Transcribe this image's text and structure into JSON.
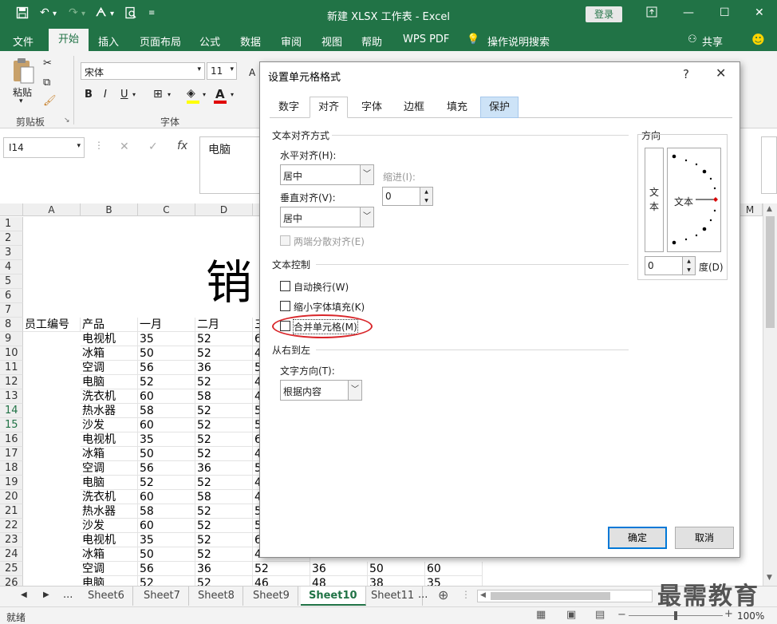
{
  "window": {
    "title": "新建 XLSX 工作表 - Excel",
    "login_label": "登录"
  },
  "menu": {
    "file": "文件",
    "home": "开始",
    "insert": "插入",
    "page_layout": "页面布局",
    "formulas": "公式",
    "data": "数据",
    "review": "审阅",
    "view": "视图",
    "help": "帮助",
    "wps_pdf": "WPS PDF",
    "tell_me": "操作说明搜索",
    "share": "共享"
  },
  "ribbon": {
    "paste": "粘贴",
    "clipboard_group": "剪贴板",
    "font_name": "宋体",
    "font_size": "11",
    "bold": "B",
    "italic": "I",
    "underline": "U",
    "font_group": "字体",
    "font_color_letter": "A",
    "font_color": "#e00000",
    "fill_color": "#ffff00"
  },
  "formula_bar": {
    "name_box": "I14",
    "cancel": "✕",
    "enter": "✓",
    "fx": "fx",
    "content": "电脑"
  },
  "grid": {
    "columns": [
      "A",
      "B",
      "C",
      "D",
      "M"
    ],
    "rows": [
      "1",
      "2",
      "3",
      "4",
      "5",
      "6",
      "7",
      "8",
      "9",
      "10",
      "11",
      "12",
      "13",
      "14",
      "15",
      "16",
      "17",
      "18",
      "19",
      "20",
      "21",
      "22",
      "23",
      "24",
      "25",
      "26"
    ],
    "big_title": "销",
    "header": [
      "员工编号",
      "产品",
      "一月",
      "二月",
      "三"
    ],
    "data": [
      [
        "电视机",
        "35",
        "52",
        "6"
      ],
      [
        "冰箱",
        "50",
        "52",
        "4"
      ],
      [
        "空调",
        "56",
        "36",
        "5"
      ],
      [
        "电脑",
        "52",
        "52",
        "4"
      ],
      [
        "洗衣机",
        "60",
        "58",
        "4"
      ],
      [
        "热水器",
        "58",
        "52",
        "5"
      ],
      [
        "沙发",
        "60",
        "52",
        "5"
      ],
      [
        "电视机",
        "35",
        "52",
        "6"
      ],
      [
        "冰箱",
        "50",
        "52",
        "4"
      ],
      [
        "空调",
        "56",
        "36",
        "5"
      ],
      [
        "电脑",
        "52",
        "52",
        "4"
      ],
      [
        "洗衣机",
        "60",
        "58",
        "4"
      ],
      [
        "热水器",
        "58",
        "52",
        "5"
      ],
      [
        "沙发",
        "60",
        "52",
        "5"
      ],
      [
        "电视机",
        "35",
        "52",
        "6"
      ],
      [
        "冰箱",
        "50",
        "52",
        "4"
      ],
      [
        "空调",
        "56",
        "36",
        "52",
        "36",
        "50",
        "60"
      ],
      [
        "电脑",
        "52",
        "52",
        "46",
        "48",
        "38",
        "35"
      ]
    ]
  },
  "sheets": {
    "nav_more": "...",
    "tabs": [
      "Sheet6",
      "Sheet7",
      "Sheet8",
      "Sheet9",
      "Sheet10",
      "Sheet11"
    ],
    "active": "Sheet10",
    "more": "..."
  },
  "status": {
    "ready": "就绪",
    "zoom": "100%"
  },
  "watermark": "最需教育",
  "dialog": {
    "title": "设置单元格格式",
    "help": "?",
    "close": "✕",
    "tabs": [
      "数字",
      "对齐",
      "字体",
      "边框",
      "填充",
      "保护"
    ],
    "active_tab": "对齐",
    "text_alignment": "文本对齐方式",
    "horizontal_label": "水平对齐(H):",
    "horizontal_value": "居中",
    "indent_label": "缩进(I):",
    "indent_value": "0",
    "vertical_label": "垂直对齐(V):",
    "vertical_value": "居中",
    "justify_distributed": "两端分散对齐(E)",
    "text_control": "文本控制",
    "wrap_text": "自动换行(W)",
    "shrink_to_fit": "缩小字体填充(K)",
    "merge_cells": "合并单元格(M)",
    "rtl": "从右到左",
    "text_direction_label": "文字方向(T):",
    "text_direction_value": "根据内容",
    "orientation": "方向",
    "orientation_vertical_text": "文本",
    "orientation_dial_text": "文本",
    "degrees_value": "0",
    "degrees_label": "度(D)",
    "ok": "确定",
    "cancel": "取消"
  }
}
